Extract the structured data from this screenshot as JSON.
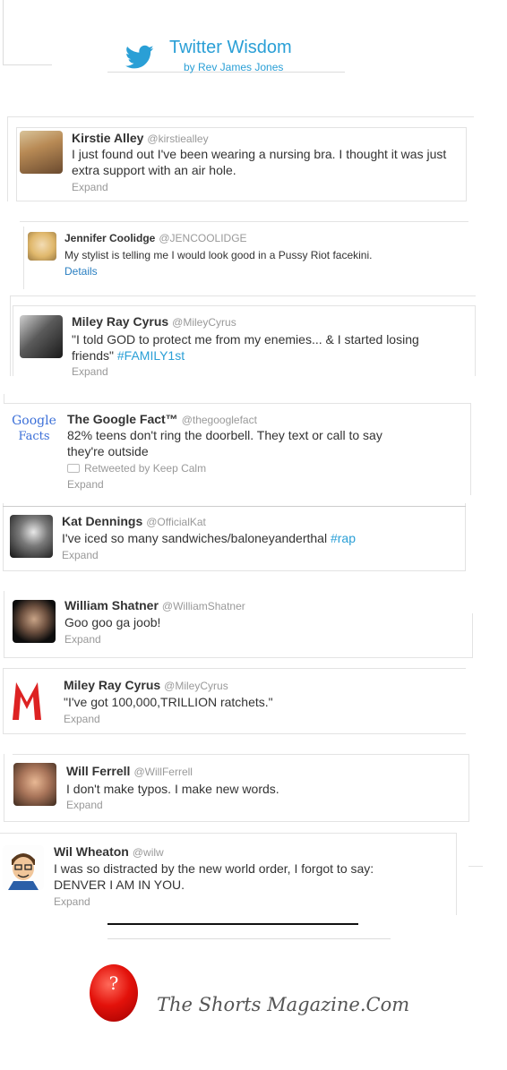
{
  "header": {
    "title": "Twitter Wisdom",
    "subtitle": "by Rev James Jones",
    "icon": "twitter-bird-icon",
    "accent_color": "#2a9fd6"
  },
  "tweets": [
    {
      "name": "Kirstie Alley",
      "handle": "@kirstiealley",
      "text": "I just found out I've been wearing a nursing bra. I thought it was just extra support with an air hole.",
      "action": "Expand"
    },
    {
      "name": "Jennifer Coolidge",
      "handle": "@JENCOOLIDGE",
      "text": "My stylist is telling me I would look good in a Pussy Riot facekini.",
      "action": "Details"
    },
    {
      "name": "Miley Ray Cyrus",
      "handle": "@MileyCyrus",
      "text": "\"I told GOD to protect me from my enemies... & I started losing friends\"",
      "hashtag": "#FAMILY1st",
      "action": "Expand"
    },
    {
      "name": "The Google Fact™",
      "handle": "@thegooglefact",
      "text": "82% teens don't ring the doorbell. They text or call to say they're outside",
      "retweet": "Retweeted by Keep Calm",
      "avatar_text_1": "Google",
      "avatar_text_2": "Facts",
      "action": "Expand"
    },
    {
      "name": "Kat Dennings",
      "handle": "@OfficialKat",
      "text": "I've iced so many sandwiches/baloneyanderthal",
      "hashtag": "#rap",
      "action": "Expand"
    },
    {
      "name": "William Shatner",
      "handle": "@WilliamShatner",
      "text": "Goo goo ga joob!",
      "action": "Expand"
    },
    {
      "name": "Miley Ray Cyrus",
      "handle": "@MileyCyrus",
      "text": "\"I've got 100,000,TRILLION ratchets.\"",
      "action": "Expand"
    },
    {
      "name": "Will Ferrell",
      "handle": "@WillFerrell",
      "text": "I don't make typos. I make new words.",
      "action": "Expand"
    },
    {
      "name": "Wil Wheaton",
      "handle": "@wilw",
      "text": "I was so distracted by the new world order, I forgot to say: DENVER I AM IN YOU.",
      "action": "Expand"
    }
  ],
  "footer": {
    "logo_mark": "?",
    "logo_text": "The Shorts Magazine.Com",
    "logo_color": "#e3120b"
  }
}
